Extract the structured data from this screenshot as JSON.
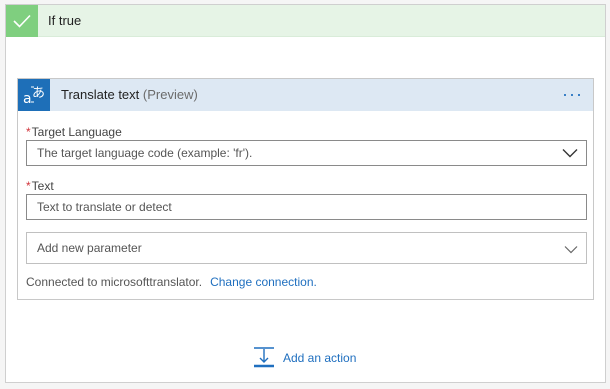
{
  "if_block": {
    "title": "If true",
    "accent_color": "#7fcf7f"
  },
  "action_card": {
    "title": "Translate text",
    "subtitle": "(Preview)",
    "icon": "translate-icon",
    "more_label": "···",
    "fields": [
      {
        "label": "Target Language",
        "required_marker": "*",
        "placeholder": "The target language code (example: 'fr').",
        "type": "dropdown"
      },
      {
        "label": "Text",
        "required_marker": "*",
        "placeholder": "Text to translate or detect",
        "type": "text"
      }
    ],
    "add_parameter_label": "Add new parameter",
    "connection_text": "Connected to microsofttranslator.",
    "change_connection_label": "Change connection."
  },
  "add_action_label": "Add an action",
  "colors": {
    "link": "#1f6fbf",
    "header_bg": "#dde8f3",
    "icon_bg": "#1e6fb8",
    "required": "#d1343b"
  }
}
